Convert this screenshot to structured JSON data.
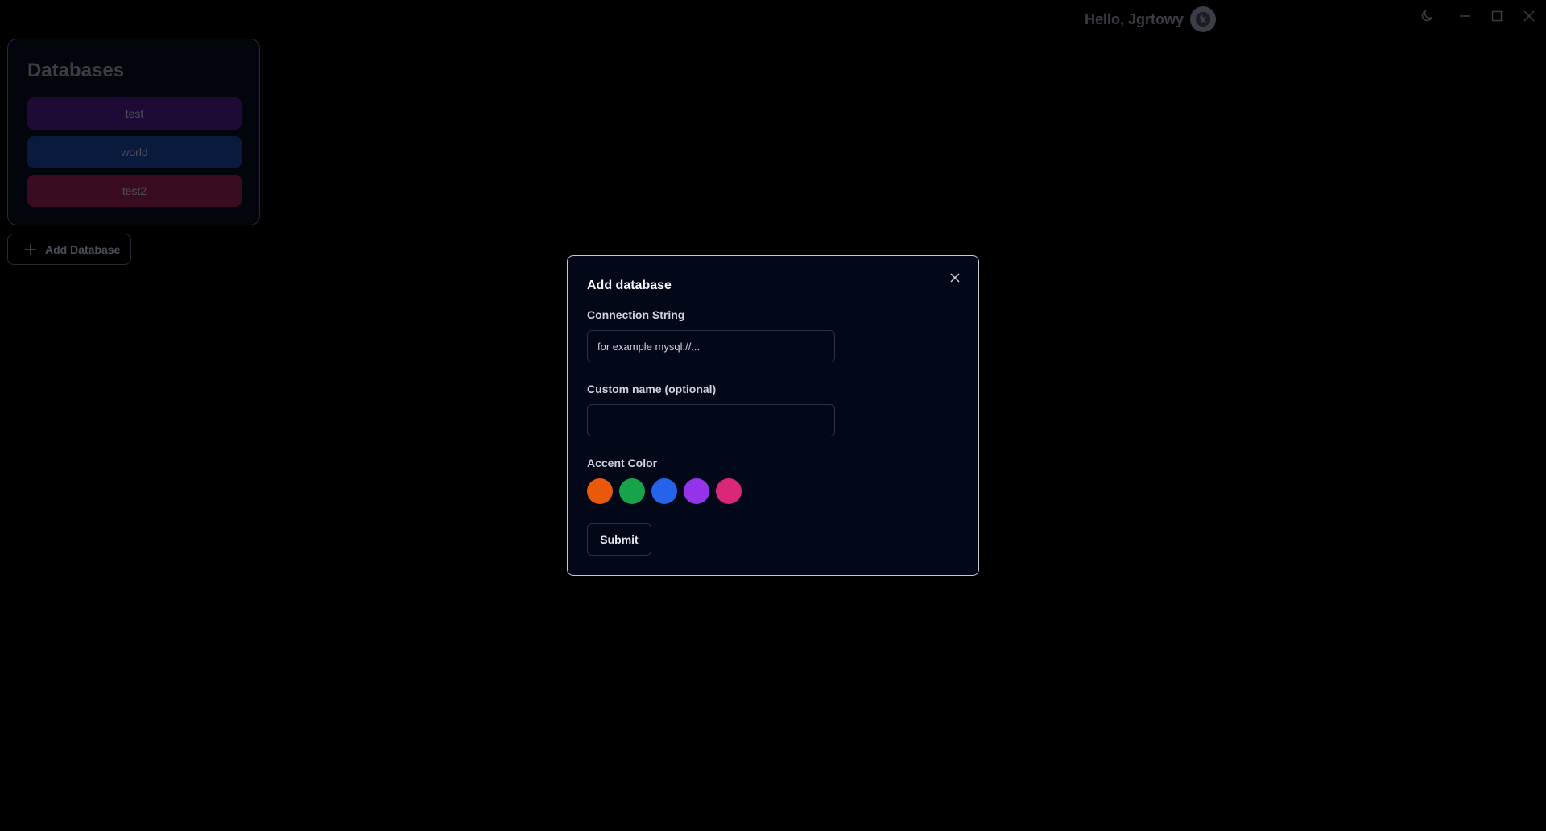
{
  "titlebar": {
    "greeting": "Hello, Jgrtowy",
    "theme_icon": "moon-icon",
    "minimize_icon": "minimize-icon",
    "maximize_icon": "maximize-icon",
    "close_icon": "close-icon"
  },
  "sidebar": {
    "title": "Databases",
    "items": [
      {
        "label": "test",
        "color": "#1e0b35"
      },
      {
        "label": "world",
        "color": "#0a1a3d"
      },
      {
        "label": "test2",
        "color": "#3a0c22"
      }
    ],
    "add_label": "Add Database"
  },
  "modal": {
    "title": "Add database",
    "connection_label": "Connection String",
    "connection_placeholder": "for example mysql://...",
    "connection_value": "",
    "custom_name_label": "Custom name (optional)",
    "custom_name_value": "",
    "accent_label": "Accent Color",
    "accent_colors": [
      "#ea580c",
      "#16a34a",
      "#2563eb",
      "#9333ea",
      "#db2777"
    ],
    "submit_label": "Submit"
  }
}
